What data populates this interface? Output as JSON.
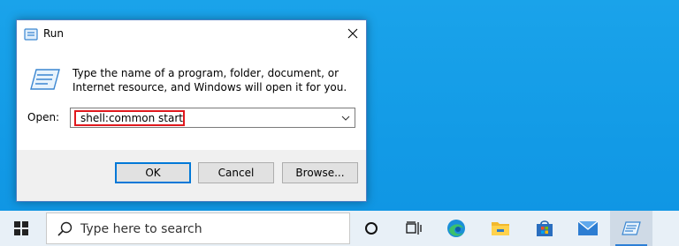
{
  "dialog": {
    "title": "Run",
    "description": "Type the name of a program, folder, document, or Internet resource, and Windows will open it for you.",
    "open_label": "Open:",
    "open_value": "shell:common startup",
    "buttons": {
      "ok": "OK",
      "cancel": "Cancel",
      "browse": "Browse..."
    }
  },
  "taskbar": {
    "search_placeholder": "Type here to search",
    "icons": [
      "windows-start-icon",
      "search-icon",
      "cortana-circle-icon",
      "task-view-icon",
      "edge-icon",
      "file-explorer-icon",
      "microsoft-store-icon",
      "mail-icon",
      "run-icon"
    ]
  },
  "colors": {
    "desktop": "#129ae6",
    "highlight_border": "#e0181d",
    "accent": "#0078d7"
  }
}
